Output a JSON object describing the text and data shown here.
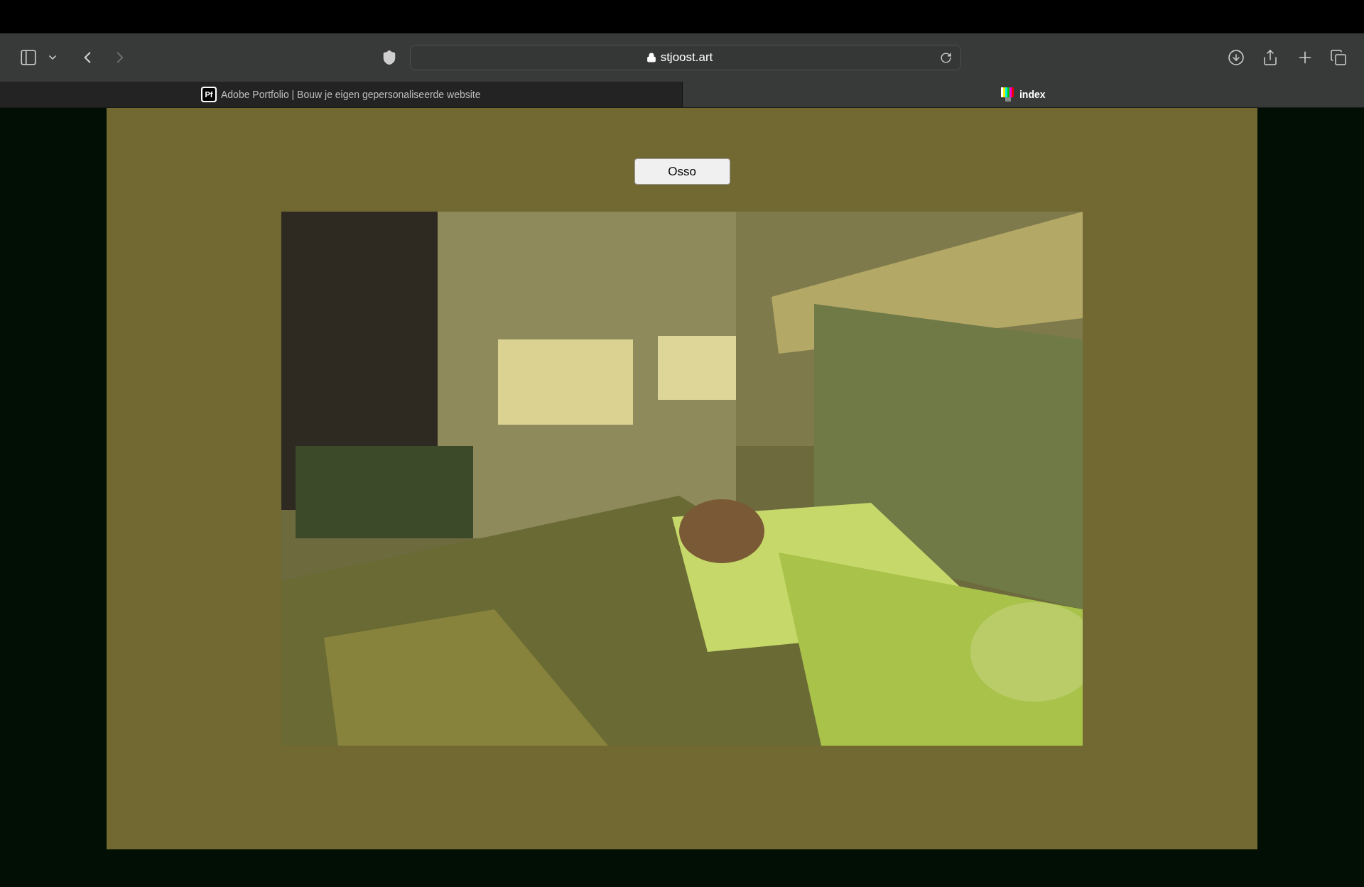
{
  "toolbar": {
    "address": "stjoost.art",
    "forward_disabled": true
  },
  "tabs": [
    {
      "title": "Adobe Portfolio | Bouw je eigen gepersonaliseerde website",
      "favicon": "Pf",
      "selected": false
    },
    {
      "title": "index",
      "selected": true
    }
  ],
  "page": {
    "button": "Osso"
  }
}
